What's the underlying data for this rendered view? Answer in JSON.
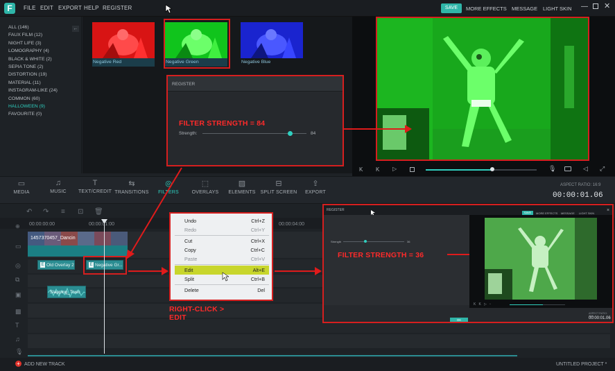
{
  "app": {
    "logo": "F",
    "menu": [
      "FILE",
      "EDIT",
      "EXPORT",
      "HELP",
      "REGISTER"
    ],
    "right_menu": {
      "save": "SAVE",
      "more_effects": "MORE EFFECTS",
      "message": "MESSAGE",
      "light_skin": "LIGHT SKIN"
    }
  },
  "sidebar": {
    "categories": [
      {
        "label": "ALL (146)"
      },
      {
        "label": "FAUX FILM (12)"
      },
      {
        "label": "NIGHT LIFE (3)"
      },
      {
        "label": "LOMOGRAPHY (4)"
      },
      {
        "label": "BLACK & WHITE (2)"
      },
      {
        "label": "SEPIA TONE (2)"
      },
      {
        "label": "DISTORTION (19)"
      },
      {
        "label": "MATERIAL (11)"
      },
      {
        "label": "INSTAGRAM-LIKE (24)"
      },
      {
        "label": "COMMON (60)"
      },
      {
        "label": "HALLOWEEN (9)",
        "active": true
      },
      {
        "label": "FAVOURITE (0)"
      }
    ]
  },
  "library": {
    "filters": [
      {
        "name": "Negative Red",
        "color": "#e01818"
      },
      {
        "name": "Negative Green",
        "color": "#14d11e"
      },
      {
        "name": "Negative Blue",
        "color": "#1e2ad8"
      }
    ]
  },
  "register_panel": {
    "title": "REGISTER",
    "annotation": "FILTER STRENGTH = 84",
    "strength_label": "Strength:",
    "strength_value": "84",
    "strength_fraction": 0.84
  },
  "preview": {
    "progress_fraction": 0.6
  },
  "toolbar": {
    "items": [
      {
        "label": "MEDIA",
        "icon": "folder-icon"
      },
      {
        "label": "MUSIC",
        "icon": "music-icon"
      },
      {
        "label": "TEXT/CREDIT",
        "icon": "text-icon"
      },
      {
        "label": "TRANSITIONS",
        "icon": "transitions-icon"
      },
      {
        "label": "FILTERS",
        "icon": "filters-icon",
        "active": true
      },
      {
        "label": "OVERLAYS",
        "icon": "overlays-icon"
      },
      {
        "label": "ELEMENTS",
        "icon": "elements-icon"
      },
      {
        "label": "SPLIT SCREEN",
        "icon": "split-screen-icon"
      },
      {
        "label": "EXPORT",
        "icon": "export-icon"
      }
    ],
    "aspect_ratio": "ASPECT RATIO: 16:9",
    "timecode": "00:00:01.06"
  },
  "timeline": {
    "ruler": [
      "00:00:00:00",
      "00:00:01:00",
      "00:00:04:00"
    ],
    "video_clip": "1457370457_Dancin",
    "filter_clip_1": "Old Overlay 2",
    "filter_clip_2": "Negative Gr...",
    "audio_clip": "Slapping_Toxic",
    "add_track": "ADD NEW TRACK",
    "project": "UNTITLED PROJECT *"
  },
  "context_menu": {
    "items": [
      {
        "label": "Undo",
        "shortcut": "Ctrl+Z"
      },
      {
        "label": "Redo",
        "shortcut": "Ctrl+Y",
        "disabled": true
      },
      {
        "label": "Cut",
        "shortcut": "Ctrl+X"
      },
      {
        "label": "Copy",
        "shortcut": "Ctrl+C"
      },
      {
        "label": "Paste",
        "shortcut": "Ctrl+V",
        "disabled": true
      },
      {
        "label": "Edit",
        "shortcut": "Alt+E",
        "highlighted": true
      },
      {
        "label": "Split",
        "shortcut": "Ctrl+B"
      },
      {
        "label": "Delete",
        "shortcut": "Del"
      }
    ],
    "annotation_line1": "RIGHT-CLICK >",
    "annotation_line2": "EDIT"
  },
  "inset": {
    "title": "REGISTER",
    "menu": {
      "save": "SAVE",
      "more_effects": "MORE EFFECTS",
      "message": "MESSAGE",
      "light_skin": "LIGHT SKIN"
    },
    "strength_label": "Strength",
    "strength_value": "36",
    "strength_fraction": 0.36,
    "annotation": "FILTER STRENGTH = 36",
    "ok": "OK",
    "aspect_ratio": "ASPECT RATIO: 16:9",
    "timecode": "00:00:01.06"
  }
}
